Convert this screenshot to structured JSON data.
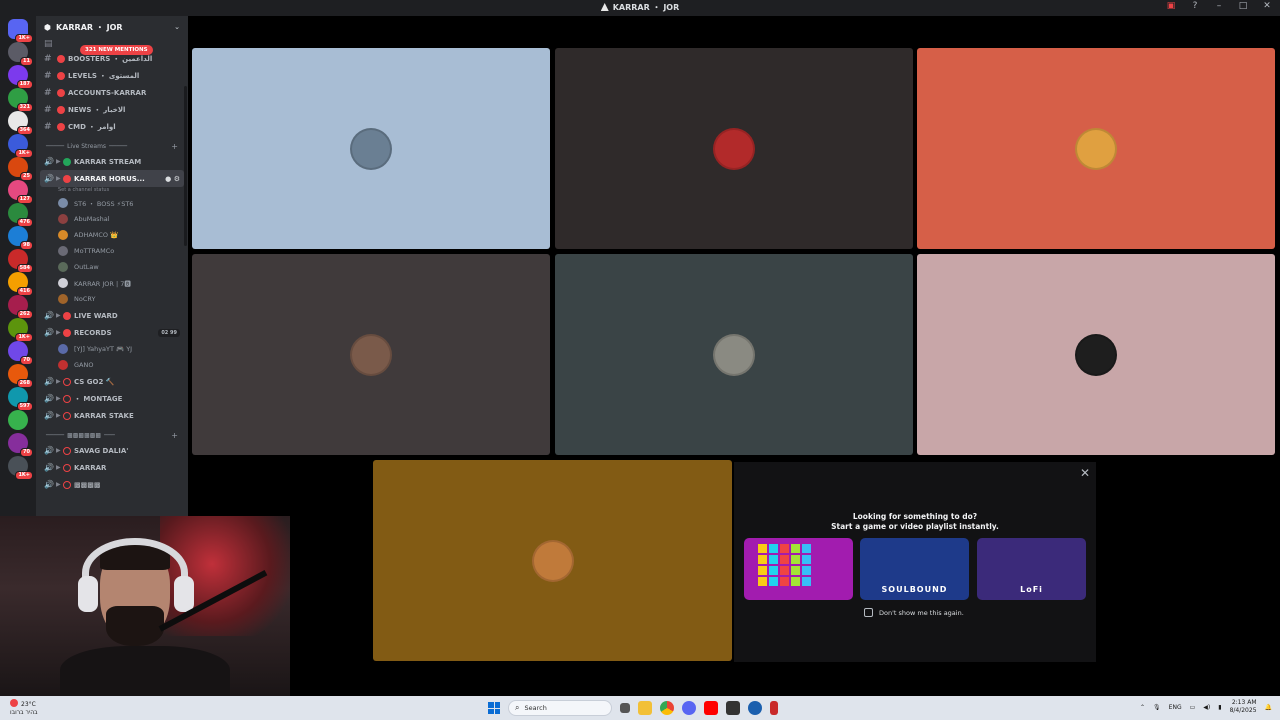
{
  "window": {
    "title": "KARRAR ・ JOR"
  },
  "rail": {
    "servers": [
      {
        "badge": "1K+",
        "color": "#c73a3a"
      },
      {
        "badge": "11",
        "color": "#5b5b66"
      },
      {
        "badge": "187",
        "color": "#7c3aed"
      },
      {
        "badge": "321",
        "color": "#2f9e44"
      },
      {
        "badge": "364",
        "color": "#e8e8e8"
      },
      {
        "badge": "1K+",
        "color": "#3b5bdb"
      },
      {
        "badge": "25",
        "color": "#d9480f"
      },
      {
        "badge": "127",
        "color": "#e64980"
      },
      {
        "badge": "476",
        "color": "#2b8a3e"
      },
      {
        "badge": "98",
        "color": "#1c7ed6"
      },
      {
        "badge": "584",
        "color": "#c92a2a"
      },
      {
        "badge": "416",
        "color": "#f59f00"
      },
      {
        "badge": "262",
        "color": "#a61e4d"
      },
      {
        "badge": "1K+",
        "color": "#5c940d"
      },
      {
        "badge": "70",
        "color": "#7048e8"
      },
      {
        "badge": "268",
        "color": "#e8590c"
      },
      {
        "badge": "597",
        "color": "#1098ad"
      },
      {
        "badge": "",
        "color": "#37b24d"
      },
      {
        "badge": "70",
        "color": "#862e9c"
      },
      {
        "badge": "1K+",
        "color": "#495057"
      }
    ]
  },
  "sidebar": {
    "server_name": "KARRAR ・ JOR",
    "mentions_pill": "321 NEW MENTIONS",
    "text_channels": [
      {
        "label": "BOOSTERS ・ الداعمين"
      },
      {
        "label": "LEVELS ・ المستوى"
      },
      {
        "label": "ACCOUNTS-KARRAR"
      },
      {
        "label": "NEWS ・ الاخبار"
      },
      {
        "label": "CMD ・ اوامر"
      }
    ],
    "category_live": "Live Streams",
    "voice_channels": [
      {
        "label": "KARRAR STREAM",
        "dot": "#23a55a"
      },
      {
        "label": "KARRAR HORUS...",
        "dot": "#ed4245"
      }
    ],
    "status_hint": "Set a channel status",
    "members": [
      {
        "name": "ST6 ・ BOSS  ⚡ST6",
        "color": "#7a8ca8"
      },
      {
        "name": "AbuMashal",
        "color": "#8c4040"
      },
      {
        "name": "ADHAMCO 👑",
        "color": "#d88a28"
      },
      {
        "name": "MoTTRAMCo",
        "color": "#6a6a75"
      },
      {
        "name": "OutLaw",
        "color": "#5a6a5a"
      },
      {
        "name": "KARRAR JOR | 7🅱",
        "color": "#d0d0d8"
      },
      {
        "name": "NoCRY",
        "color": "#a0642a"
      }
    ],
    "more_voice": [
      {
        "label": "LIVE WARD"
      },
      {
        "label": "RECORDS",
        "count": "02  99"
      }
    ],
    "record_members": [
      {
        "name": "[YJ] YahyaYT 🎮 YJ",
        "color": "#5a6aa8"
      },
      {
        "name": "GANO",
        "color": "#c03030"
      }
    ],
    "games_channels": [
      {
        "label": "CS GO2 🔨"
      },
      {
        "label": "・ MONTAGE"
      },
      {
        "label": "KARRAR STAKE"
      }
    ],
    "category_two": "▩▩▩▩▩▩",
    "bottom_channels": [
      {
        "label": "SAVAG DALIA'"
      },
      {
        "label": "KARRAR"
      },
      {
        "label": "▩▩▩▩"
      }
    ]
  },
  "stage": {
    "tiles": [
      {
        "bg": "#a8bdd4",
        "avatar": "#6a7f93"
      },
      {
        "bg": "#2f2a2a",
        "avatar": "#b22a2a"
      },
      {
        "bg": "#d65f48",
        "avatar": "#e0a040"
      },
      {
        "bg": "#403a3b",
        "avatar": "#7a5a4a"
      },
      {
        "bg": "#3a4446",
        "avatar": "#8a8a82"
      },
      {
        "bg": "#c8a6a8",
        "avatar": "#1e1e1e"
      },
      {
        "bg": "#825b14",
        "avatar": "#c07a3a"
      }
    ]
  },
  "activity": {
    "heading1": "Looking for something to do?",
    "heading2": "Start a game or video playlist instantly.",
    "games": [
      {
        "name": "blocks",
        "caption": "",
        "bg": "#a21caf"
      },
      {
        "name": "soulbound",
        "caption": "SOULBOUND",
        "bg": "#1e3a8a"
      },
      {
        "name": "lofi",
        "caption": "LoFi",
        "bg": "#3b2a7a"
      }
    ],
    "dont_show": "Don't show me this again."
  },
  "taskbar": {
    "weather_temp": "23°C",
    "weather_desc": "בהיר ברובו",
    "search_placeholder": "Search",
    "lang": "ENG",
    "time": "2:13 AM",
    "date": "8/4/2025"
  }
}
